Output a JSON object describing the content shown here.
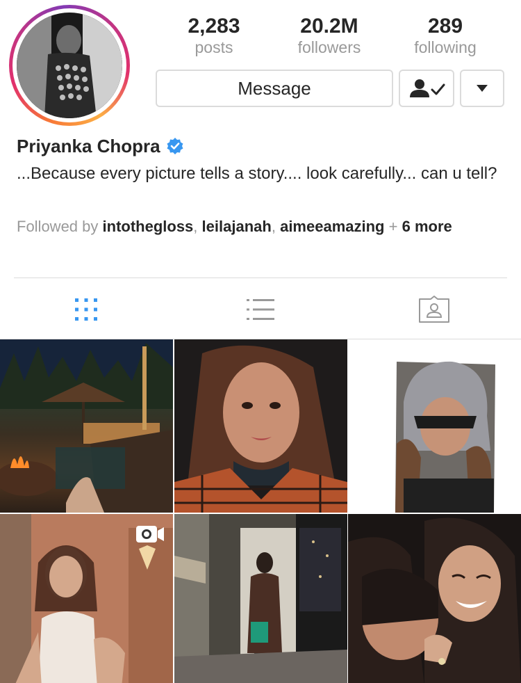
{
  "profile": {
    "name": "Priyanka Chopra",
    "verified": true,
    "bio": "...Because every picture tells a story.... look carefully... can u tell?",
    "avatar_icon": "profile-photo",
    "ring_colors": [
      "#f77737",
      "#e1306c",
      "#c13584",
      "#833ab4",
      "#fcaf45"
    ]
  },
  "stats": {
    "posts": {
      "value": "2,283",
      "label": "posts"
    },
    "followers": {
      "value": "20.2M",
      "label": "followers"
    },
    "following": {
      "value": "289",
      "label": "following"
    }
  },
  "actions": {
    "message_label": "Message",
    "following_icon": "person-check-icon",
    "more_icon": "caret-down-icon"
  },
  "followed_by": {
    "prefix": "Followed by",
    "users": [
      "intothegloss",
      "leilajanah",
      "aimeeamazing"
    ],
    "separator": ",",
    "plus": "+",
    "more": "6 more"
  },
  "tabs": [
    {
      "name": "grid",
      "icon": "grid-icon",
      "active": true,
      "color": "#3897f0"
    },
    {
      "name": "list",
      "icon": "list-icon",
      "active": false,
      "color": "#999999"
    },
    {
      "name": "tagged",
      "icon": "tagged-person-icon",
      "active": false,
      "color": "#999999"
    }
  ],
  "posts": [
    {
      "kind": "photo"
    },
    {
      "kind": "photo"
    },
    {
      "kind": "photo"
    },
    {
      "kind": "video"
    },
    {
      "kind": "photo"
    },
    {
      "kind": "photo"
    }
  ],
  "colors": {
    "accent": "#3897f0",
    "text": "#262626",
    "muted": "#999999",
    "border": "#dbdbdb"
  }
}
